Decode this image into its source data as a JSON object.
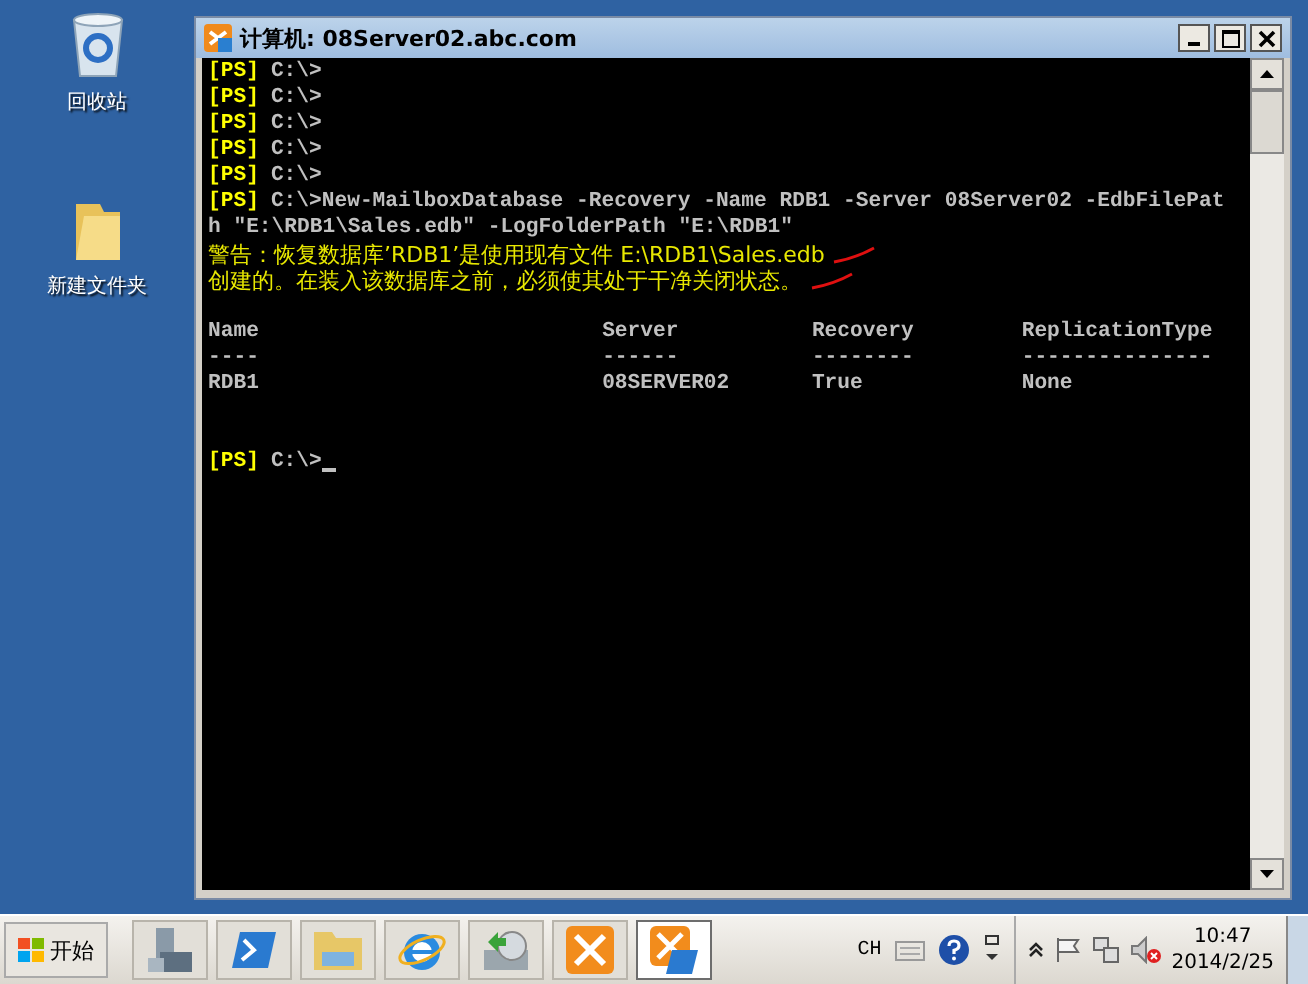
{
  "desktop_icons": [
    {
      "kind": "recycle-bin",
      "label": "回收站"
    },
    {
      "kind": "folder",
      "label": "新建文件夹"
    }
  ],
  "window": {
    "title": "计算机: 08Server02.abc.com"
  },
  "console": {
    "lines": [
      {
        "kind": "prompt",
        "prefix": "[PS]",
        "text": "C:\\>"
      },
      {
        "kind": "prompt",
        "prefix": "[PS]",
        "text": "C:\\>"
      },
      {
        "kind": "prompt",
        "prefix": "[PS]",
        "text": "C:\\>"
      },
      {
        "kind": "prompt",
        "prefix": "[PS]",
        "text": "C:\\>"
      },
      {
        "kind": "prompt",
        "prefix": "[PS]",
        "text": "C:\\>"
      },
      {
        "kind": "prompt",
        "prefix": "[PS]",
        "text": "C:\\>New-MailboxDatabase -Recovery -Name RDB1 -Server 08Server02 -EdbFilePat"
      },
      {
        "kind": "output",
        "text": "h \"E:\\RDB1\\Sales.edb\" -LogFolderPath \"E:\\RDB1\""
      },
      {
        "kind": "warning",
        "text": "警告：恢复数据库’RDB1’是使用现有文件 E:\\RDB1\\Sales.edb"
      },
      {
        "kind": "warning",
        "text": "创建的。在装入该数据库之前，必须使其处于干净关闭状态。"
      }
    ],
    "table": {
      "columns": [
        "Name",
        "Server",
        "Recovery",
        "ReplicationType"
      ],
      "dividers": [
        "----",
        "------",
        "--------",
        "---------------"
      ],
      "rows": [
        [
          "RDB1",
          "08SERVER02",
          "True",
          "None"
        ]
      ]
    },
    "final_prompt": {
      "prefix": "[PS]",
      "text": "C:\\>"
    }
  },
  "taskbar": {
    "start": "开始",
    "tasks": [
      {
        "kind": "server",
        "selected": false
      },
      {
        "kind": "shell",
        "selected": false
      },
      {
        "kind": "explorer",
        "selected": false
      },
      {
        "kind": "browser",
        "selected": false
      },
      {
        "kind": "installer",
        "selected": false
      },
      {
        "kind": "exchange",
        "selected": false
      },
      {
        "kind": "exchange-shell",
        "selected": true
      }
    ],
    "language": "CH",
    "time": "10:47",
    "date": "2014/2/25"
  }
}
